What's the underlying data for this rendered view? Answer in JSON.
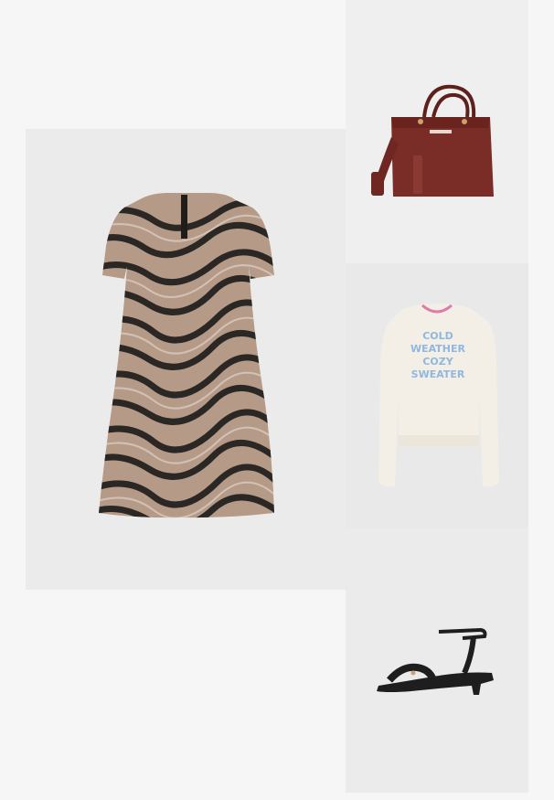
{
  "outfit": {
    "items": [
      {
        "id": "dress",
        "image_alt": "zebra-print-dress-image"
      },
      {
        "id": "bag",
        "image_alt": "burgundy-tote-bag-image"
      },
      {
        "id": "sweater",
        "image_alt": "cream-sweater-image"
      },
      {
        "id": "sandal",
        "image_alt": "black-sandal-image"
      }
    ],
    "sweater_print": {
      "line1": "COLD",
      "line2": "WEATHER",
      "line3": "COZY",
      "line4": "SWEATER"
    },
    "colors": {
      "page_bg": "#f6f6f6",
      "tile_bg": "#ececec",
      "dress_base": "#b59a88",
      "dress_stripe": "#2a2724",
      "bag": "#7a2c26",
      "sweater": "#f3efe6",
      "sweater_text": "#8fb8e0",
      "sandal": "#1e1e1e"
    }
  }
}
